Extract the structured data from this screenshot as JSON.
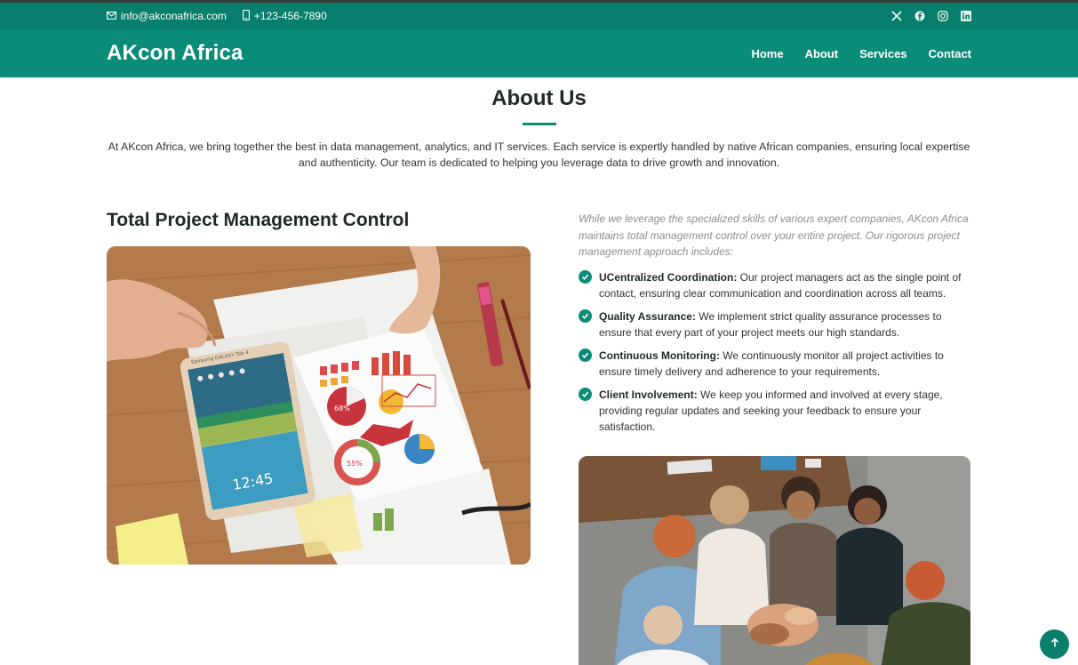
{
  "topbar": {
    "email": "info@akconafrica.com",
    "phone": "+123-456-7890",
    "email_icon": "envelope-icon",
    "phone_icon": "phone-icon",
    "social_icons": [
      "x-twitter-icon",
      "facebook-icon",
      "instagram-icon",
      "linkedin-icon"
    ]
  },
  "header": {
    "brand": "AKcon Africa",
    "nav": [
      "Home",
      "About",
      "Services",
      "Contact"
    ]
  },
  "about": {
    "title": "About Us",
    "text": "At AKcon Africa, we bring together the best in data management, analytics, and IT services. Each service is expertly handled by native African companies, ensuring local expertise and authenticity. Our team is dedicated to helping you leverage data to drive growth and innovation."
  },
  "project": {
    "title": "Total Project Management Control",
    "intro": "While we leverage the specialized skills of various expert companies, AKcon Africa maintains total management control over your entire project. Our rigorous project management approach includes:",
    "features": [
      {
        "title": "UCentralized Coordination:",
        "text": " Our project managers act as the single point of contact, ensuring clear communication and coordination across all teams."
      },
      {
        "title": "Quality Assurance:",
        "text": " We implement strict quality assurance processes to ensure that every part of your project meets our high standards."
      },
      {
        "title": "Continuous Monitoring:",
        "text": " We continuously monitor all project activities to ensure timely delivery and adherence to your requirements."
      },
      {
        "title": "Client Involvement:",
        "text": " We keep you informed and involved at every stage, providing regular updates and seeking your feedback to ensure your satisfaction."
      }
    ],
    "check_icon": "check-circle-icon",
    "tablet_time": "12:45",
    "tablet_brand": "Samsung GALAXY Tab 4",
    "chart_percent_1": "68%",
    "chart_percent_2": "55%"
  },
  "colors": {
    "accent": "#0a8c78",
    "topbar": "#087f6c",
    "heading": "#1e2a28"
  },
  "back_to_top_icon": "arrow-up-icon"
}
